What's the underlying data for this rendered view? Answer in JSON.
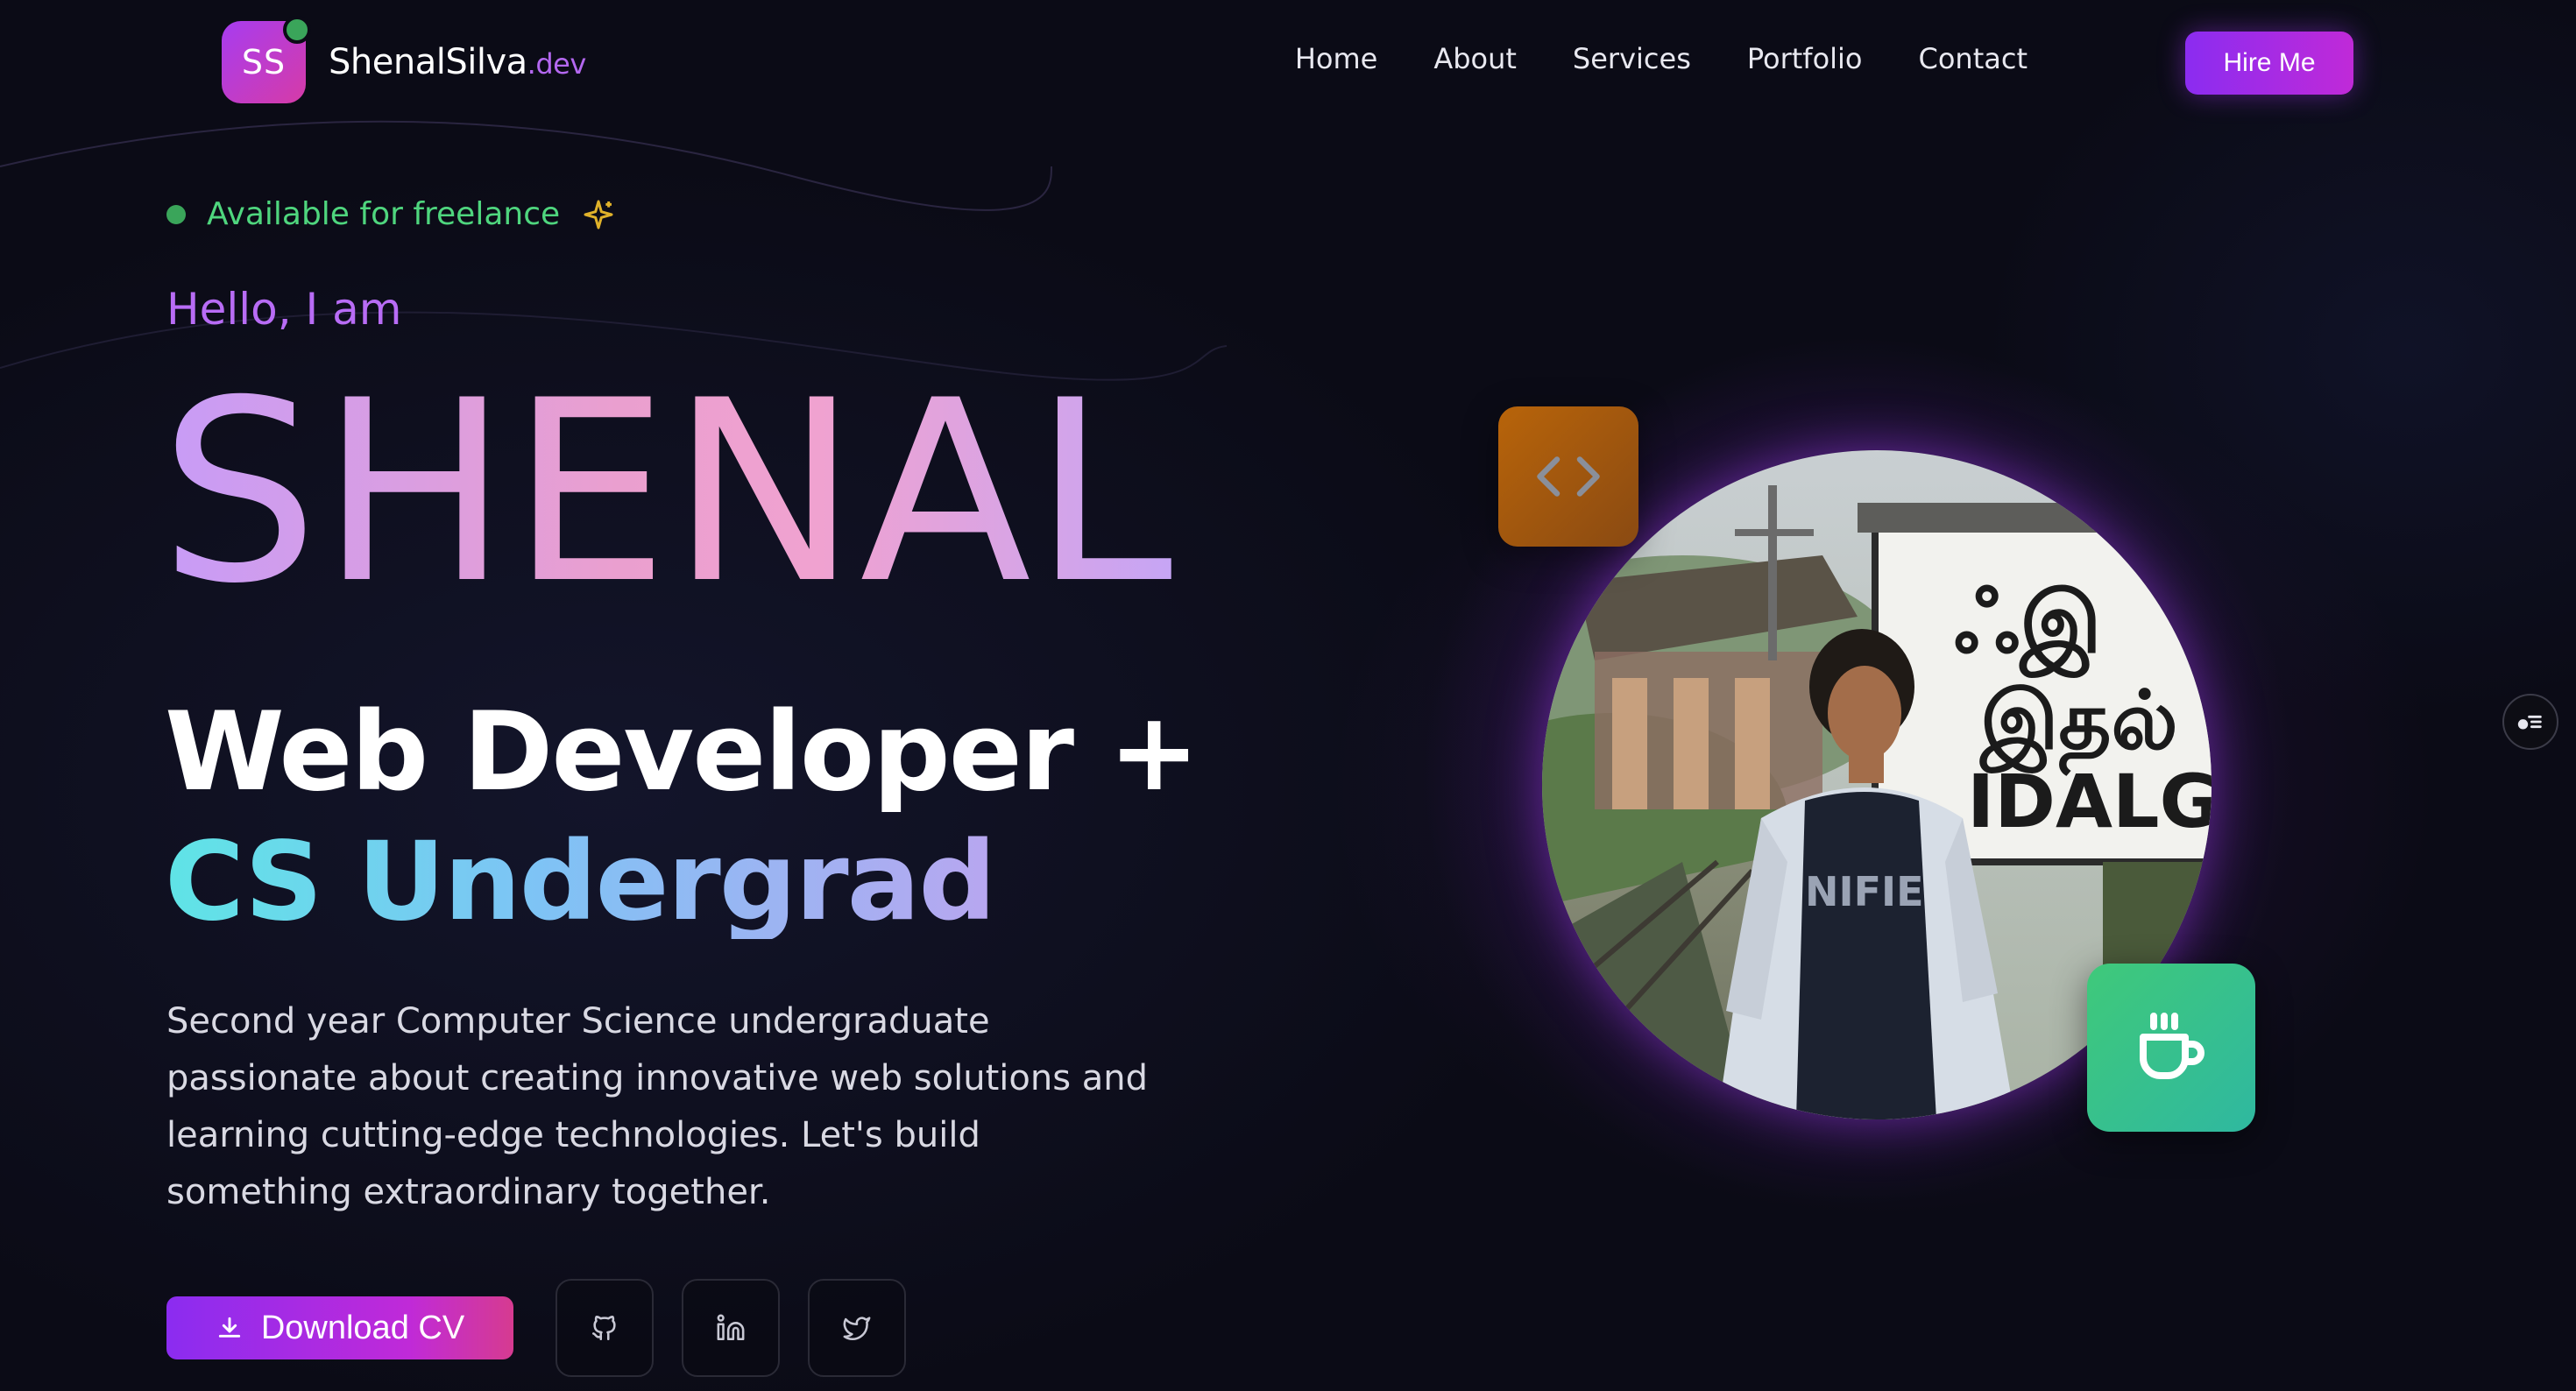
{
  "brand": {
    "initials": "SS",
    "name": "ShenalSilva",
    "tld": ".dev"
  },
  "nav": {
    "items": [
      "Home",
      "About",
      "Services",
      "Portfolio",
      "Contact"
    ],
    "cta_label": "Hire Me"
  },
  "hero": {
    "availability": "Available for freelance",
    "greeting": "Hello, I am",
    "name": "SHENAL",
    "role_line1": "Web Developer +",
    "role_line2": "CS Undergrad",
    "description": "Second year Computer Science undergraduate passionate about creating innovative web solutions and learning cutting-edge technologies. Let's build something extraordinary together.",
    "cv_label": "Download CV",
    "socials": [
      {
        "icon": "github-icon"
      },
      {
        "icon": "linkedin-icon"
      },
      {
        "icon": "twitter-icon"
      }
    ]
  },
  "visual": {
    "photo_subject": "profile-photo",
    "station_sign_text": "IDALG",
    "badges": [
      {
        "icon": "code-icon",
        "color": "#b8640a"
      },
      {
        "icon": "coffee-cup-icon",
        "color": "#3fc97a"
      }
    ]
  },
  "colors": {
    "accent_purple": "#8b2cf0",
    "accent_pink": "#c02ad8",
    "available_green": "#4fd67e",
    "background": "#0b0b16"
  }
}
